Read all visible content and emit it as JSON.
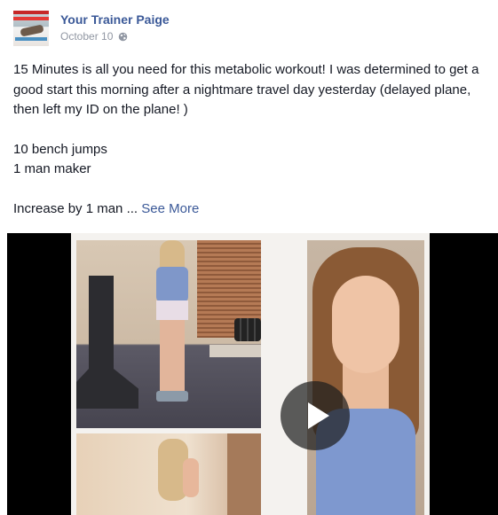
{
  "post": {
    "author": "Your Trainer Paige",
    "date": "October 10",
    "privacy_icon": "globe-icon",
    "paragraphs": [
      "15 Minutes is all you need for this metabolic workout! I was determined to get a good start this morning after a nightmare travel day yesterday (delayed plane, then left my ID on the plane! )",
      "10 bench jumps",
      "1 man maker",
      "Increase by 1 man ..."
    ],
    "see_more": "See More"
  },
  "video": {
    "play_icon": "play-icon"
  },
  "colors": {
    "link": "#3b5998",
    "meta": "#9197a3",
    "text": "#141823"
  }
}
